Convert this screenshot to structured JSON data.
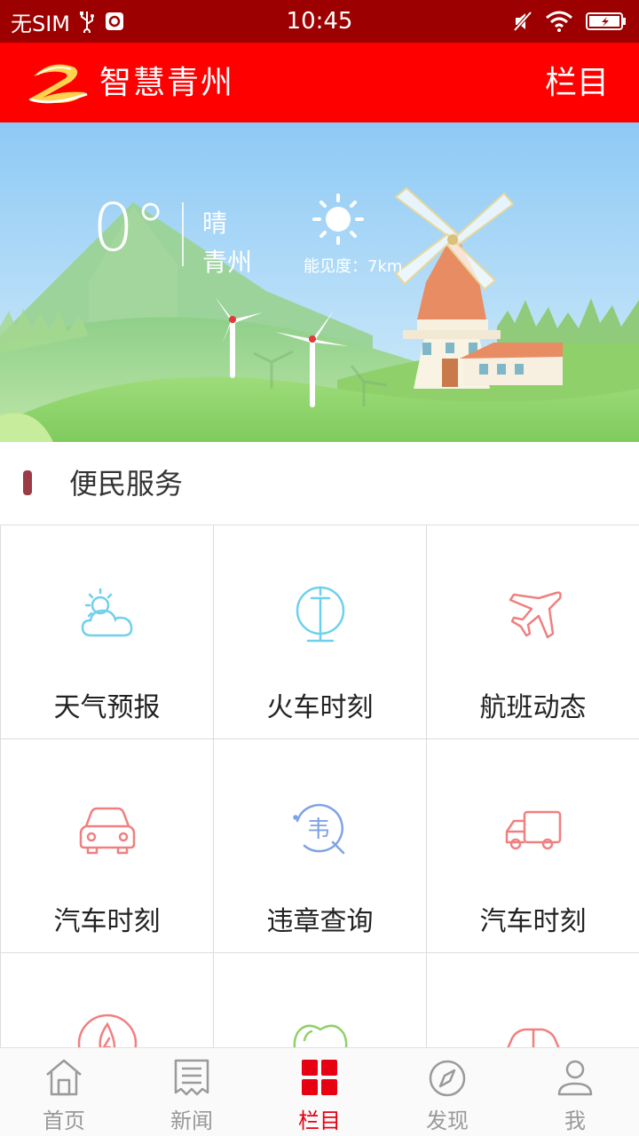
{
  "status_bar": {
    "carrier": "无SIM",
    "time": "10:45"
  },
  "header": {
    "title": "智慧青州",
    "columns_label": "栏目"
  },
  "weather": {
    "temperature": "0°",
    "condition": "晴",
    "city": "青州",
    "visibility": "能见度：7km"
  },
  "section": {
    "title": "便民服务"
  },
  "services": [
    {
      "label": "天气预报",
      "icon": "weather-icon"
    },
    {
      "label": "火车时刻",
      "icon": "train-icon"
    },
    {
      "label": "航班动态",
      "icon": "airplane-icon"
    },
    {
      "label": "汽车时刻",
      "icon": "car-icon"
    },
    {
      "label": "违章查询",
      "icon": "violation-search-icon"
    },
    {
      "label": "汽车时刻",
      "icon": "truck-icon"
    },
    {
      "label": "",
      "icon": "fire-icon"
    },
    {
      "label": "",
      "icon": "apple-icon"
    },
    {
      "label": "",
      "icon": "car-icon"
    }
  ],
  "bottom_nav": [
    {
      "label": "首页",
      "icon": "home-icon"
    },
    {
      "label": "新闻",
      "icon": "news-icon"
    },
    {
      "label": "栏目",
      "icon": "grid-icon",
      "active": true
    },
    {
      "label": "发现",
      "icon": "compass-icon"
    },
    {
      "label": "我",
      "icon": "user-icon"
    }
  ],
  "colors": {
    "status_bar": "#9c0000",
    "header": "#fe0000",
    "accent": "#e60012",
    "icon_blue": "#6fd0ee",
    "icon_red": "#f08080"
  }
}
